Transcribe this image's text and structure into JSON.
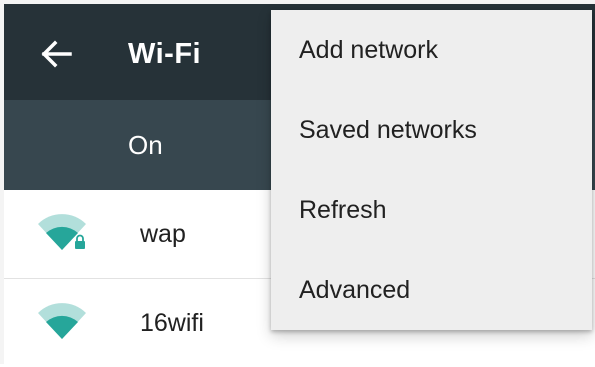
{
  "toolbar": {
    "title": "Wi-Fi",
    "back_icon": "arrow-left-icon",
    "background": "#263238"
  },
  "switch_bar": {
    "label": "On",
    "background": "#37474f"
  },
  "networks": [
    {
      "name": "wap",
      "secured": true,
      "icon": "wifi-lock-icon"
    },
    {
      "name": "16wifi",
      "secured": false,
      "icon": "wifi-icon"
    }
  ],
  "overflow_menu": {
    "items": [
      {
        "label": "Add network"
      },
      {
        "label": "Saved networks"
      },
      {
        "label": "Refresh"
      },
      {
        "label": "Advanced"
      }
    ]
  },
  "colors": {
    "accent": "#26a69a"
  }
}
